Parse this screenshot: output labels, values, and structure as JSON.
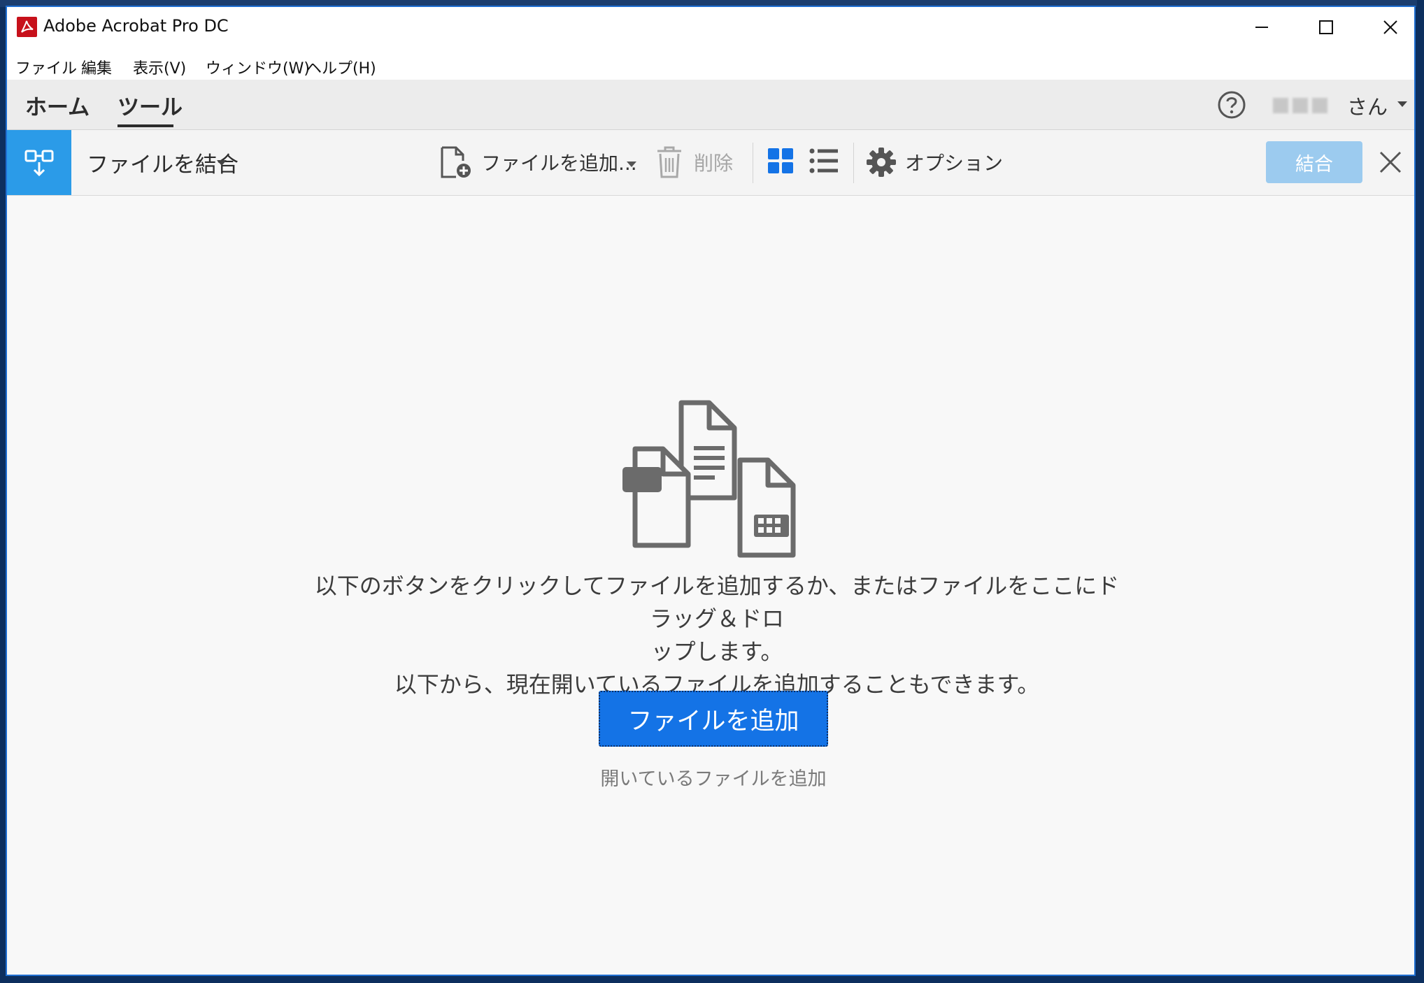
{
  "window": {
    "title": "Adobe Acrobat Pro DC",
    "controls": [
      "minimize",
      "maximize",
      "close"
    ]
  },
  "menubar": {
    "items": [
      "ファイル",
      "編集",
      "表示(V)",
      "ウィンドウ(W)",
      "ヘルプ(H)"
    ]
  },
  "tabs": {
    "home": "ホーム",
    "tools": "ツール",
    "active": "ツール"
  },
  "account": {
    "name_suffix": "さん"
  },
  "toolbar": {
    "tool_name": "ファイルを結合",
    "add_files": "ファイルを追加...",
    "delete": "削除",
    "options": "オプション",
    "combine": "結合"
  },
  "main": {
    "instruction_line1": "以下のボタンをクリックしてファイルを追加するか、またはファイルをここにドラッグ＆ドロ",
    "instruction_line2": "ップします。",
    "instruction_line3": "以下から、現在開いているファイルを追加することもできます。",
    "add_button": "ファイルを追加",
    "add_open_link": "開いているファイルを追加"
  },
  "colors": {
    "accent_blue": "#1473e6",
    "tool_badge": "#2b9be8",
    "combine_disabled": "#9ccbef",
    "grid_view_icon": "#1473e6",
    "acrobat_red": "#c7111b"
  }
}
